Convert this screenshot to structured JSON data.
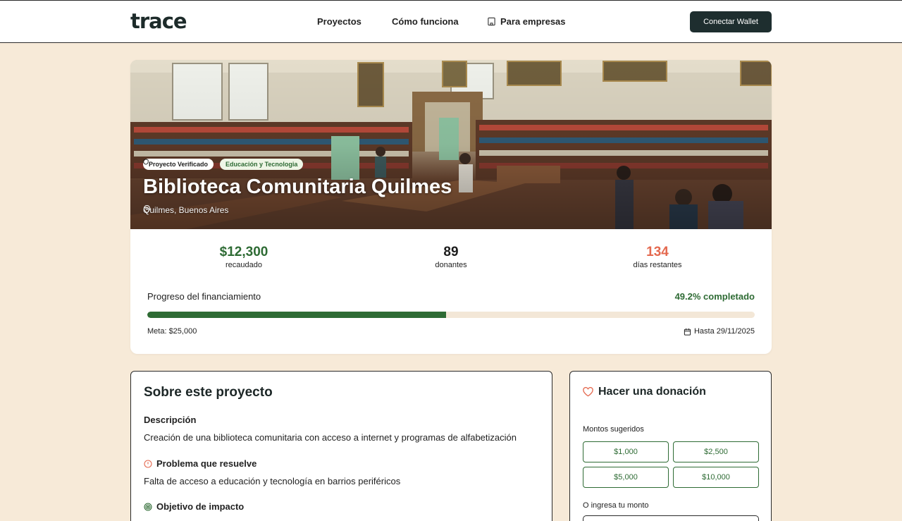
{
  "nav": {
    "logo": "trace",
    "links": [
      "Proyectos",
      "Cómo funciona",
      "Para empresas"
    ],
    "wallet_button": "Conectar Wallet"
  },
  "project": {
    "badge_verified": "Proyecto Verificado",
    "badge_category": "Educación y Tecnologia",
    "title": "Biblioteca Comunitaria Quilmes",
    "location": "Quilmes, Buenos Aires"
  },
  "stats": {
    "raised_value": "$12,300",
    "raised_label": "recaudado",
    "donors_value": "89",
    "donors_label": "donantes",
    "days_value": "134",
    "days_label": "días restantes"
  },
  "progress": {
    "label": "Progreso del financiamiento",
    "percent_text": "49.2% completado",
    "fraction": 0.492,
    "goal": "Meta: $25,000",
    "deadline": "Hasta 29/11/2025"
  },
  "about": {
    "title": "Sobre este proyecto",
    "description_heading": "Descripción",
    "description": "Creación de una biblioteca comunitaria con acceso a internet y programas de alfabetización",
    "problem_heading": "Problema que resuelve",
    "problem": "Falta de acceso a educación y tecnología en barrios periféricos",
    "objective_heading": "Objetivo de impacto"
  },
  "donation": {
    "title": "Hacer una donación",
    "suggested_label": "Montos sugeridos",
    "amounts": [
      "$1,000",
      "$2,500",
      "$5,000",
      "$10,000"
    ],
    "custom_label": "O ingresa tu monto"
  },
  "colors": {
    "accent_green": "#2e6b34",
    "accent_coral": "#e4694f",
    "dark_button": "#1e2e2f",
    "page_bg": "#f7ead8"
  },
  "icons": {
    "empresas": "building-icon",
    "verified": "shield-icon",
    "location": "map-pin-icon",
    "deadline": "calendar-icon",
    "problem": "alert-circle-icon",
    "objective": "target-icon",
    "donation": "heart-icon"
  }
}
